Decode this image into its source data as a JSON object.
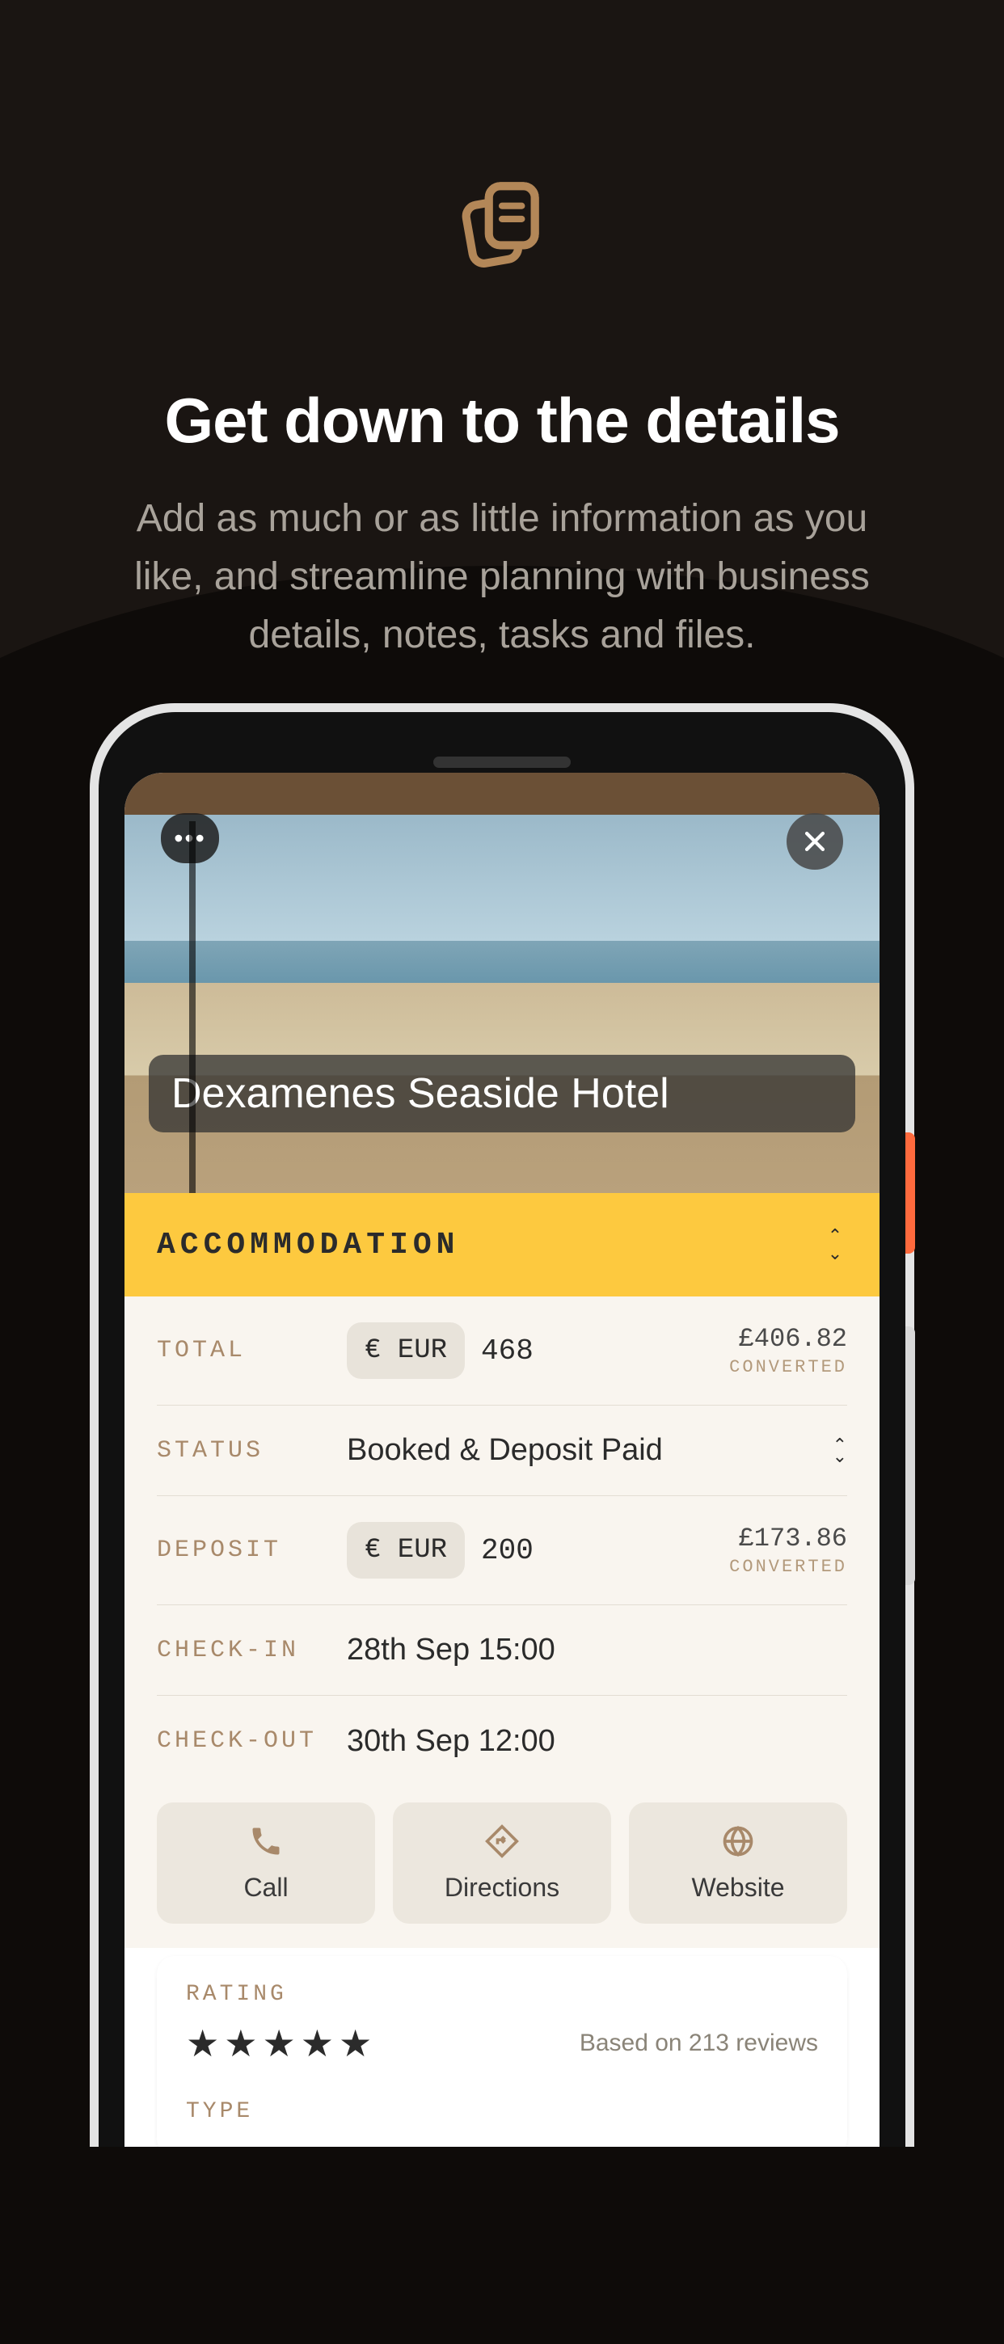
{
  "promo": {
    "title": "Get down to the details",
    "subtitle": "Add as much or as little information as you like, and streamline planning with business details, notes, tasks and files."
  },
  "hotel": {
    "name": "Dexamenes Seaside Hotel",
    "category": "ACCOMMODATION"
  },
  "fields": {
    "total": {
      "label": "TOTAL",
      "currency": "€ EUR",
      "amount": "468",
      "converted": "£406.82",
      "converted_label": "CONVERTED"
    },
    "status": {
      "label": "STATUS",
      "value": "Booked & Deposit Paid"
    },
    "deposit": {
      "label": "DEPOSIT",
      "currency": "€ EUR",
      "amount": "200",
      "converted": "£173.86",
      "converted_label": "CONVERTED"
    },
    "checkin": {
      "label": "CHECK-IN",
      "value": "28th Sep 15:00"
    },
    "checkout": {
      "label": "CHECK-OUT",
      "value": "30th Sep 12:00"
    }
  },
  "actions": {
    "call": "Call",
    "directions": "Directions",
    "website": "Website"
  },
  "rating": {
    "label": "RATING",
    "stars": "★★★★★",
    "reviews": "Based on 213 reviews",
    "type_label": "TYPE"
  }
}
